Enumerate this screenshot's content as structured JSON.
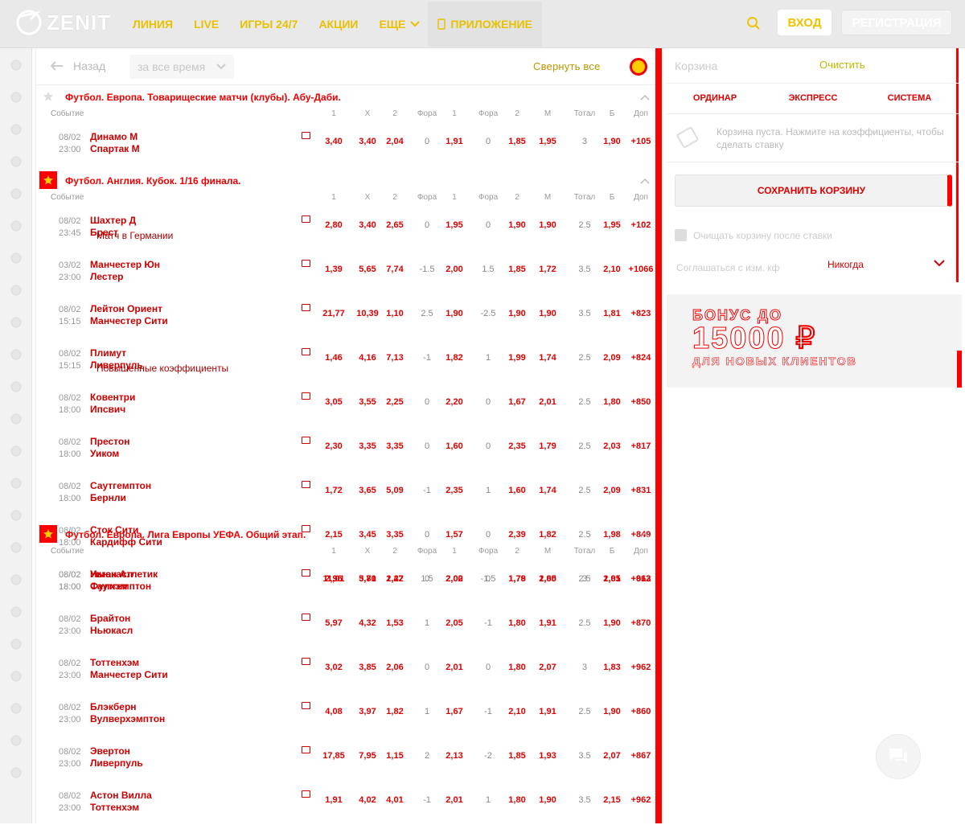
{
  "header": {
    "logo_text": "ZENIT",
    "nav": [
      "ЛИНИЯ",
      "LIVE",
      "ИГРЫ 24/7",
      "АКЦИИ",
      "ЕЩЕ",
      "ПРИЛОЖЕНИЕ"
    ],
    "login": "ВХОД",
    "register": "РЕГИСТРАЦИЯ"
  },
  "left_rail_icons": [
    "menu-icon",
    "calendar-icon",
    "search-icon",
    "star-icon",
    "fire-icon",
    "soccer-icon",
    "ticket-icon",
    "ball-icon",
    "ball-icon",
    "ball-icon",
    "ball-icon",
    "gamepad-icon",
    "ball-icon",
    "ball-icon",
    "cup-icon",
    "feather-icon",
    "ball-icon",
    "feather-icon",
    "sport-icon",
    "dots-icon",
    "sport-icon",
    "sport-icon",
    "sport-icon"
  ],
  "main": {
    "back": "Назад",
    "period": "за все время",
    "collapse_all": "Свернуть все"
  },
  "columns": [
    "Событие",
    "1",
    "X",
    "2",
    "Фора",
    "1",
    "Фора",
    "2",
    "М",
    "Тотал",
    "Б",
    "Доп"
  ],
  "sections": [
    {
      "title": "Футбол. Европа. Товарищеские матчи (клубы). Абу-Даби.",
      "rows": [
        {
          "date": "08/02",
          "time": "23:00",
          "team1": "Динамо М",
          "team2": "Спартак М",
          "note": "",
          "odds": [
            "3,40",
            "3,40",
            "2,04",
            "0",
            "1,91",
            "0",
            "1,85",
            "1,95",
            "3",
            "1,90",
            "+105"
          ]
        }
      ]
    },
    {
      "title": "Футбол. Англия. Кубок. 1/16 финала.",
      "rows": [
        {
          "date": "08/02",
          "time": "23:45",
          "team1": "Шахтер Д",
          "team2": "Брест",
          "note": "Матч в Германии",
          "odds": [
            "2,80",
            "3,40",
            "2,65",
            "0",
            "1,95",
            "0",
            "1,90",
            "1,90",
            "2.5",
            "1,95",
            "+102"
          ]
        },
        {
          "date": "03/02",
          "time": "23:00",
          "team1": "Манчестер Юн",
          "team2": "Лестер",
          "note": "",
          "odds": [
            "1,39",
            "5,65",
            "7,74",
            "-1.5",
            "2,00",
            "1.5",
            "1,85",
            "1,72",
            "3.5",
            "2,10",
            "+1066"
          ]
        },
        {
          "date": "08/02",
          "time": "15:15",
          "team1": "Лейтон Ориент",
          "team2": "Манчестер Сити",
          "note": "",
          "odds": [
            "21,77",
            "10,39",
            "1,10",
            "2.5",
            "1,90",
            "-2.5",
            "1,90",
            "1,90",
            "3.5",
            "1,81",
            "+823"
          ]
        },
        {
          "date": "08/02",
          "time": "15:15",
          "team1": "Плимут",
          "team2": "Ливерпуль",
          "note": "Повышенные коэффициенты",
          "odds": [
            "1,46",
            "4,16",
            "7,13",
            "-1",
            "1,82",
            "1",
            "1,99",
            "1,74",
            "2.5",
            "2,09",
            "+824"
          ]
        },
        {
          "date": "08/02",
          "time": "18:00",
          "team1": "Ковентри",
          "team2": "Ипсвич",
          "note": "",
          "odds": [
            "3,05",
            "3,55",
            "2,25",
            "0",
            "2,20",
            "0",
            "1,67",
            "2,01",
            "2.5",
            "1,80",
            "+850"
          ]
        },
        {
          "date": "08/02",
          "time": "18:00",
          "team1": "Престон",
          "team2": "Уиком",
          "note": "",
          "odds": [
            "2,30",
            "3,35",
            "3,35",
            "0",
            "1,60",
            "0",
            "2,35",
            "1,79",
            "2.5",
            "2,03",
            "+817"
          ]
        },
        {
          "date": "08/02",
          "time": "18:00",
          "team1": "Саутгемптон",
          "team2": "Бернли",
          "note": "",
          "odds": [
            "1,72",
            "3,65",
            "5,09",
            "-1",
            "2,35",
            "1",
            "1,60",
            "1,74",
            "2.5",
            "2,09",
            "+831"
          ]
        },
        {
          "date": "08/02",
          "time": "18:00",
          "team1": "Сток Сити",
          "team2": "Кардифф Сити",
          "note": "",
          "odds": [
            "2,15",
            "3,45",
            "3,35",
            "0",
            "1,57",
            "0",
            "2,39",
            "1,82",
            "2.5",
            "1,98",
            "+849"
          ]
        },
        {
          "date": "08/02",
          "time": "18:00",
          "team1": "Уиган Атлетик",
          "team2": "Фулхэм",
          "note": "",
          "odds": [
            "11,01",
            "5,71",
            "1,27",
            "1.5",
            "2,02",
            "-1.5",
            "1,79",
            "1,80",
            "3",
            "2,01",
            "+812"
          ]
        }
      ]
    },
    {
      "title": "Футбол. Европа. Лига Европы УЕФА. Общий этап.",
      "rows": [
        {
          "date": "08/02",
          "time": "18:00",
          "team1": "Ньюкасл",
          "team2": "Саутгемптон",
          "note": "",
          "odds": [
            "2,96",
            "3,80",
            "2,42",
            "0",
            "2,00",
            "0",
            "1,78",
            "2,05",
            "2.5",
            "1,85",
            "+963"
          ]
        },
        {
          "date": "08/02",
          "time": "23:00",
          "team1": "Брайтон",
          "team2": "Ньюкасл",
          "note": "",
          "odds": [
            "5,97",
            "4,32",
            "1,53",
            "1",
            "2,05",
            "-1",
            "1,80",
            "1,91",
            "2.5",
            "1,90",
            "+870"
          ]
        },
        {
          "date": "08/02",
          "time": "23:00",
          "team1": "Тоттенхэм",
          "team2": "Манчестер Сити",
          "note": "",
          "odds": [
            "3,02",
            "3,85",
            "2,06",
            "0",
            "2,01",
            "0",
            "1,80",
            "2,07",
            "3",
            "1,83",
            "+962"
          ]
        },
        {
          "date": "08/02",
          "time": "23:00",
          "team1": "Блэкберн",
          "team2": "Вулверхэмптон",
          "note": "",
          "odds": [
            "4,08",
            "3,97",
            "1,82",
            "1",
            "1,67",
            "-1",
            "2,10",
            "1,91",
            "2.5",
            "1,90",
            "+860"
          ]
        },
        {
          "date": "08/02",
          "time": "23:00",
          "team1": "Эвертон",
          "team2": "Ливерпуль",
          "note": "",
          "odds": [
            "17,85",
            "7,95",
            "1,15",
            "2",
            "2,13",
            "-2",
            "1,85",
            "1,93",
            "3.5",
            "2,07",
            "+867"
          ]
        },
        {
          "date": "08/02",
          "time": "23:00",
          "team1": "Астон Вилла",
          "team2": "Тоттенхэм",
          "note": "",
          "odds": [
            "1,91",
            "4,02",
            "4,01",
            "-1",
            "2,01",
            "1",
            "1,80",
            "1,90",
            "3.5",
            "2,15",
            "+962"
          ]
        }
      ]
    }
  ],
  "cart": {
    "title": "Корзина",
    "clear": "Очистить",
    "tabs": [
      "ОРДИНАР",
      "ЭКСПРЕСС",
      "СИСТЕМА"
    ],
    "empty_msg": "Корзина пуста. Нажмите на коэффициенты, чтобы сделать ставку",
    "save": "СОХРАНИТЬ КОРЗИНУ",
    "clear_after": "Очищать корзину после ставки",
    "accept_label": "Соглашаться с изм. кф",
    "accept_value": "Никогда"
  },
  "banner": {
    "line1": "БОНУС ДО",
    "line2": "15000 ₽",
    "line3": "ДЛЯ НОВЫХ КЛИЕНТОВ"
  }
}
